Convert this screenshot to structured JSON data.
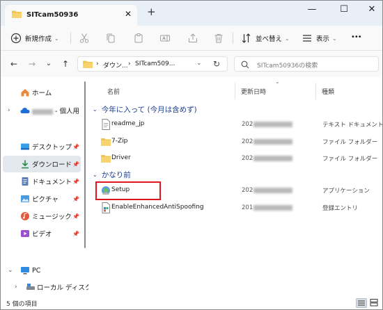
{
  "window": {
    "tab_title": "SITcam50936",
    "close_tab": "✕",
    "new_tab": "+",
    "minimize": "—",
    "maximize": "☐",
    "close": "✕"
  },
  "toolbar": {
    "new_label": "新規作成",
    "sort_label": "並べ替え",
    "view_label": "表示",
    "more": "•••",
    "chevron": "⌄"
  },
  "nav": {
    "back": "←",
    "forward": "→",
    "recent": "⌄",
    "up": "↑",
    "refresh": "↻"
  },
  "address": {
    "crumb_sep": "›",
    "crumbs": [
      "ダウン...",
      "SITcam509..."
    ],
    "dropdown": "⌄"
  },
  "search": {
    "placeholder": "SITcam50936の検索"
  },
  "sidebar": {
    "home": "ホーム",
    "cloud_suffix": "- 個人用",
    "pinned": [
      {
        "label": "デスクトップ"
      },
      {
        "label": "ダウンロード"
      },
      {
        "label": "ドキュメント"
      },
      {
        "label": "ピクチャ"
      },
      {
        "label": "ミュージック"
      },
      {
        "label": "ビデオ"
      }
    ],
    "pc": "PC",
    "local_disk": "ローカル ディスク"
  },
  "list": {
    "columns": {
      "name": "名前",
      "modified": "更新日時",
      "type": "種類"
    },
    "groups": [
      {
        "label": "今年に入って (今月は含めず)"
      },
      {
        "label": "かなり前"
      }
    ],
    "rows": [
      {
        "name": "readme_jp",
        "date_prefix": "202",
        "type": "テキスト ドキュメント"
      },
      {
        "name": "7-Zip",
        "date_prefix": "202",
        "type": "ファイル フォルダー"
      },
      {
        "name": "Driver",
        "date_prefix": "202",
        "type": "ファイル フォルダー"
      },
      {
        "name": "Setup",
        "date_prefix": "202",
        "type": "アプリケーション"
      },
      {
        "name": "EnableEnhancedAntiSpoofing",
        "date_prefix": "201",
        "type": "登録エントリ"
      }
    ]
  },
  "status": {
    "count": "5 個の項目"
  },
  "colors": {
    "accent": "#1d3f8f",
    "folder": "#f4c44c",
    "highlight": "#e0161d"
  }
}
